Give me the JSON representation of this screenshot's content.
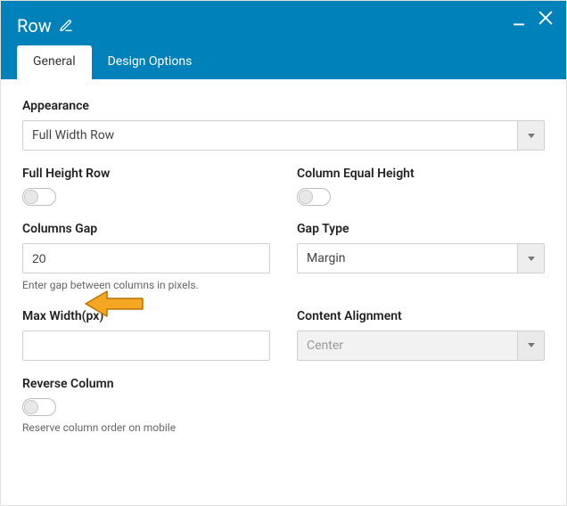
{
  "header": {
    "title": "Row"
  },
  "tabs": {
    "general": "General",
    "design": "Design Options"
  },
  "fields": {
    "appearance": {
      "label": "Appearance",
      "value": "Full Width Row"
    },
    "fullHeight": {
      "label": "Full Height Row"
    },
    "colEqualHeight": {
      "label": "Column Equal Height"
    },
    "columnsGap": {
      "label": "Columns Gap",
      "value": "20",
      "desc": "Enter gap between columns in pixels."
    },
    "gapType": {
      "label": "Gap Type",
      "value": "Margin"
    },
    "maxWidth": {
      "label": "Max Width(px)",
      "value": ""
    },
    "contentAlignment": {
      "label": "Content Alignment",
      "value": "Center"
    },
    "reverseColumn": {
      "label": "Reverse Column",
      "desc": "Reserve column order on mobile"
    }
  }
}
